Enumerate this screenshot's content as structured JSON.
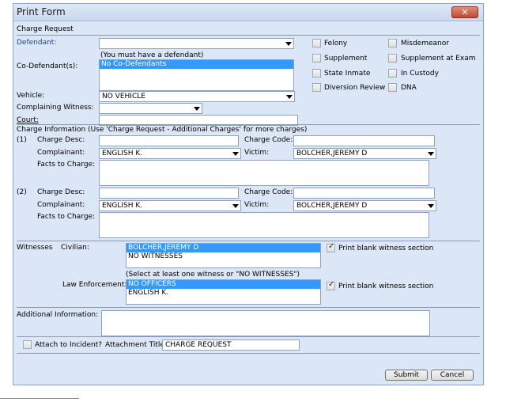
{
  "window": {
    "title": "Print Form",
    "close_label": "✕"
  },
  "section_charge_request": "Charge Request",
  "defendant": {
    "label": "Defendant:",
    "value": "",
    "hint": "(You must have a defendant)"
  },
  "codefendants": {
    "label": "Co-Defendant(s):",
    "items": [
      "No Co-Defendants"
    ]
  },
  "vehicle": {
    "label": "Vehicle:",
    "value": "NO VEHICLE"
  },
  "complaining_witness": {
    "label": "Complaining Witness:",
    "value": ""
  },
  "court": {
    "label": "Court:",
    "value": ""
  },
  "flags": [
    {
      "label": "Felony",
      "checked": false
    },
    {
      "label": "Misdemeanor",
      "checked": false
    },
    {
      "label": "Supplement",
      "checked": false
    },
    {
      "label": "Supplement at Exam",
      "checked": false
    },
    {
      "label": "State Inmate",
      "checked": false
    },
    {
      "label": "In Custody",
      "checked": false
    },
    {
      "label": "Diversion Review",
      "checked": false
    },
    {
      "label": "DNA",
      "checked": false
    }
  ],
  "charge_info": {
    "header": "Charge Information (Use 'Charge Request - Additional Charges' for more charges)",
    "charges": [
      {
        "index": "(1)",
        "desc_label": "Charge Desc:",
        "desc": "",
        "code_label": "Charge Code:",
        "code": "",
        "complainant_label": "Complainant:",
        "complainant": "ENGLISH K.",
        "victim_label": "Victim:",
        "victim": "BOLCHER,JEREMY D",
        "facts_label": "Facts to Charge:",
        "facts": ""
      },
      {
        "index": "(2)",
        "desc_label": "Charge Desc:",
        "desc": "",
        "code_label": "Charge Code:",
        "code": "",
        "complainant_label": "Complainant:",
        "complainant": "ENGLISH K.",
        "victim_label": "Victim:",
        "victim": "BOLCHER,JEREMY D",
        "facts_label": "Facts to Charge:",
        "facts": ""
      }
    ]
  },
  "witnesses": {
    "label": "Witnesses",
    "civilian_label": "Civilian:",
    "civilian_items": [
      "BOLCHER,JEREMY D",
      "NO WITNESSES"
    ],
    "print_blank_label": "Print blank witness section",
    "select_hint": "(Select at least one witness or \"NO WITNESSES\")",
    "law_label": "Law Enforcement:",
    "law_items": [
      "NO OFFICERS",
      "ENGLISH K."
    ],
    "print_blank_label2": "Print blank witness section"
  },
  "additional_info": {
    "label": "Additional Information:",
    "value": ""
  },
  "attach": {
    "label": "Attach to Incident?",
    "title_label": "Attachment Title:",
    "title_value": "CHARGE REQUEST"
  },
  "buttons": {
    "submit": "Submit",
    "cancel": "Cancel"
  },
  "colors": {
    "window_bg": "#dbe6f6",
    "selection": "#3399ff",
    "defendant_label": "#1a3fb0"
  }
}
